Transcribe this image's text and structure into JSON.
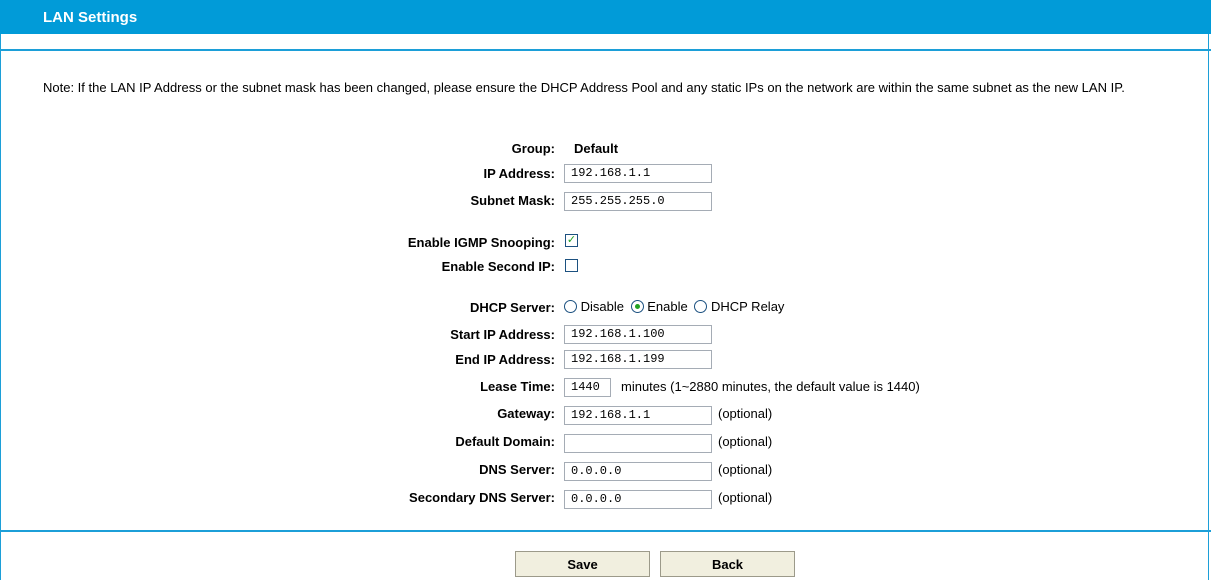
{
  "header": {
    "title": "LAN Settings"
  },
  "note": "Note: If the LAN IP Address or the subnet mask has been changed, please ensure the DHCP Address Pool and any static IPs on the network are within the same subnet as the new LAN IP.",
  "group": {
    "label": "Group:",
    "value": "Default"
  },
  "ip_address": {
    "label": "IP Address:",
    "value": "192.168.1.1"
  },
  "subnet_mask": {
    "label": "Subnet Mask:",
    "value": "255.255.255.0"
  },
  "igmp": {
    "label": "Enable IGMP Snooping:",
    "checked": true,
    "mark": "✓"
  },
  "second_ip": {
    "label": "Enable Second IP:",
    "checked": false
  },
  "dhcp": {
    "label": "DHCP Server:",
    "options": [
      "Disable",
      "Enable",
      "DHCP Relay"
    ],
    "selected": "Enable"
  },
  "start_ip": {
    "label": "Start IP Address:",
    "value": "192.168.1.100"
  },
  "end_ip": {
    "label": "End IP Address:",
    "value": "192.168.1.199"
  },
  "lease": {
    "label": "Lease Time:",
    "value": "1440",
    "hint": "minutes (1~2880 minutes, the default value is 1440)"
  },
  "gateway": {
    "label": "Gateway:",
    "value": "192.168.1.1",
    "hint": "(optional)"
  },
  "domain": {
    "label": "Default Domain:",
    "value": "",
    "hint": "(optional)"
  },
  "dns": {
    "label": "DNS Server:",
    "value": "0.0.0.0",
    "hint": "(optional)"
  },
  "dns2": {
    "label": "Secondary DNS Server:",
    "value": "0.0.0.0",
    "hint": "(optional)"
  },
  "buttons": {
    "save": "Save",
    "back": "Back"
  }
}
